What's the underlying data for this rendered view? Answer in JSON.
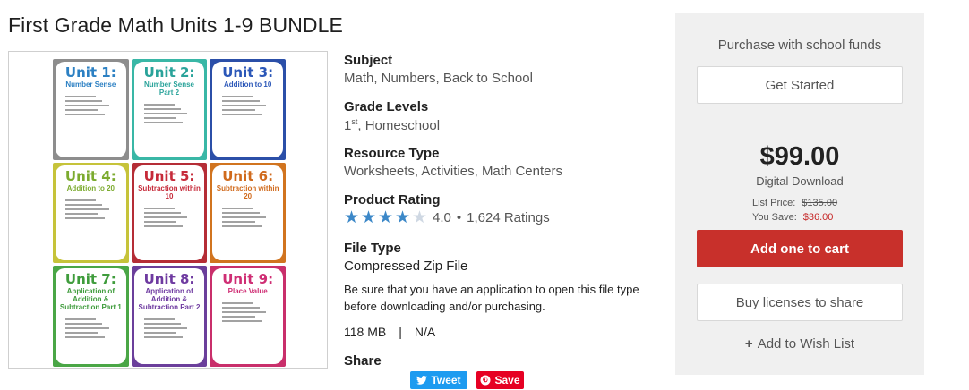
{
  "product": {
    "title": "First Grade Math Units 1-9 BUNDLE"
  },
  "image": {
    "posters": [
      {
        "unit": "Unit 1:",
        "sub": "Number Sense",
        "bg": "#8d8d8d",
        "fg": "#2c80c3"
      },
      {
        "unit": "Unit 2:",
        "sub": "Number Sense Part 2",
        "bg": "#39b7a6",
        "fg": "#2aa39a"
      },
      {
        "unit": "Unit 3:",
        "sub": "Addition to 10",
        "bg": "#2b4fa8",
        "fg": "#2b57b8"
      },
      {
        "unit": "Unit 4:",
        "sub": "Addition to 20",
        "bg": "#c6c33a",
        "fg": "#7cab2f"
      },
      {
        "unit": "Unit 5:",
        "sub": "Subtraction within 10",
        "bg": "#b52d36",
        "fg": "#c62b3a"
      },
      {
        "unit": "Unit 6:",
        "sub": "Subtraction within 20",
        "bg": "#d1741f",
        "fg": "#d06a1c"
      },
      {
        "unit": "Unit 7:",
        "sub": "Application of Addition & Subtraction Part 1",
        "bg": "#4aa646",
        "fg": "#3f9c3c"
      },
      {
        "unit": "Unit 8:",
        "sub": "Application of Addition & Subtraction Part 2",
        "bg": "#6b3f9b",
        "fg": "#6e3aa0"
      },
      {
        "unit": "Unit 9:",
        "sub": "Place Value",
        "bg": "#c92f6b",
        "fg": "#cf2e74"
      }
    ]
  },
  "subject": {
    "label": "Subject",
    "value": "Math, Numbers, Back to School"
  },
  "grade": {
    "label": "Grade Levels",
    "first": "1",
    "first_sup": "st",
    "rest": ", Homeschool"
  },
  "resource": {
    "label": "Resource Type",
    "value": "Worksheets, Activities, Math Centers"
  },
  "rating": {
    "label": "Product Rating",
    "score": "4.0",
    "sep": "•",
    "count": "1,624 Ratings",
    "stars_filled": 4,
    "stars_total": 5
  },
  "file": {
    "label": "File Type",
    "value": "Compressed Zip File",
    "note": "Be sure that you have an application to open this file type before downloading and/or purchasing.",
    "size": "118 MB",
    "divider": "|",
    "pages": "N/A"
  },
  "share": {
    "label": "Share",
    "tweet": "Tweet",
    "pin": "Save"
  },
  "panel": {
    "heading": "Purchase with school funds",
    "get_started": "Get Started",
    "price": "$99.00",
    "digital": "Digital Download",
    "list_label": "List Price:",
    "list_value": "$135.00",
    "save_label": "You Save:",
    "save_value": "$36.00",
    "cart": "Add one to cart",
    "licenses": "Buy licenses to share",
    "wish_plus": "+",
    "wish": "Add to Wish List"
  },
  "colors": {
    "cart": "#c8302b",
    "star": "#3c88c8",
    "tweet": "#1d9bf0",
    "pin": "#e60023",
    "save": "#c62828"
  }
}
